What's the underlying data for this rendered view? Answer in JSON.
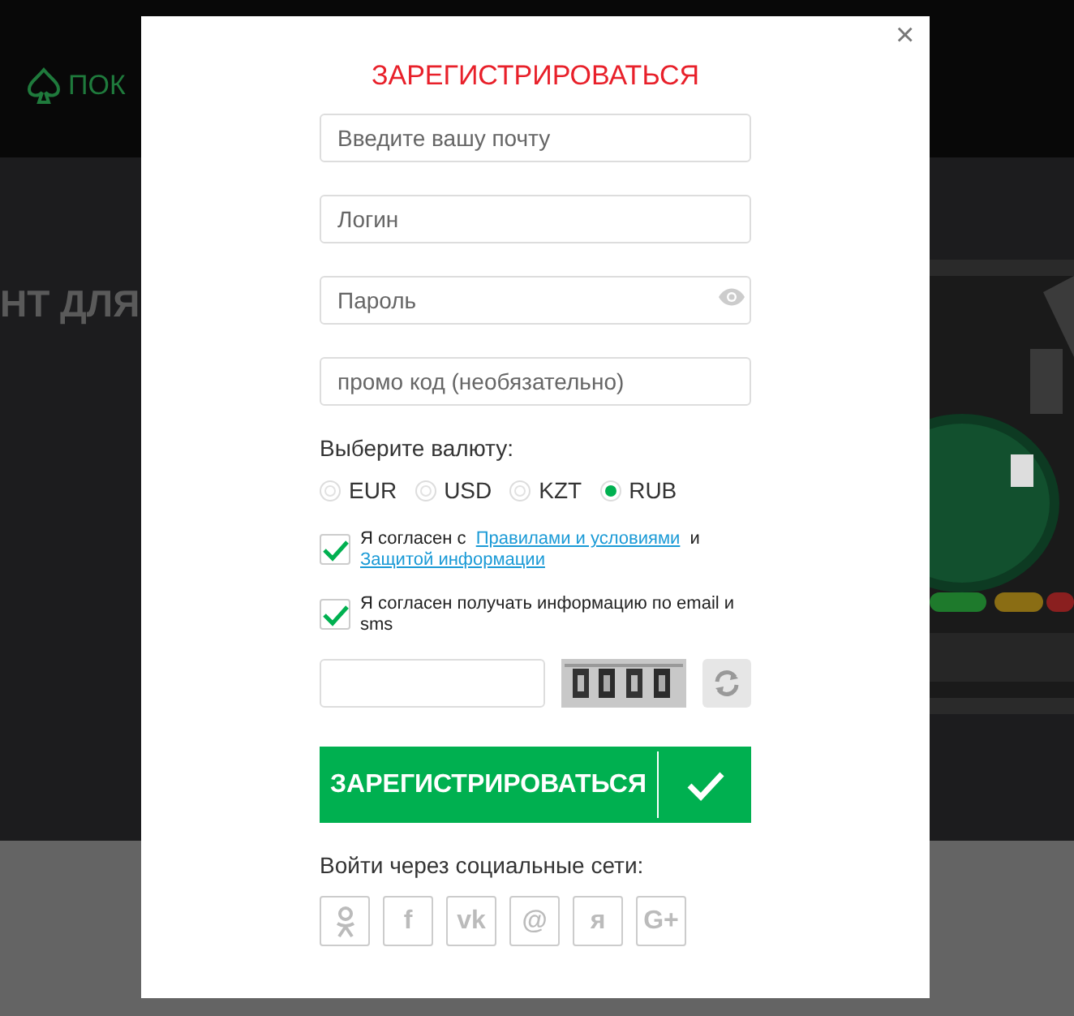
{
  "background": {
    "logo_text": "ПОК",
    "headline": "НТ ДЛЯ"
  },
  "modal": {
    "close": "×",
    "title": "ЗАРЕГИСТРИРОВАТЬСЯ",
    "fields": [
      {
        "placeholder": "Введите вашу почту",
        "kind": "text"
      },
      {
        "placeholder": "Логин",
        "kind": "text"
      },
      {
        "placeholder": "Пароль",
        "kind": "password"
      },
      {
        "placeholder": "промо код (необязательно)",
        "kind": "text"
      }
    ],
    "currency_label": "Выберите валюту:",
    "currencies": [
      {
        "label": "EUR",
        "selected": false
      },
      {
        "label": "USD",
        "selected": false
      },
      {
        "label": "KZT",
        "selected": false
      },
      {
        "label": "RUB",
        "selected": true
      }
    ],
    "agreements": [
      {
        "checked": true,
        "text": "Я согласен с",
        "links": [
          "Правилами и условиями",
          "Защитой информации"
        ],
        "joiner": "и"
      },
      {
        "checked": true,
        "text": "Я согласен получать информацию по email и sms"
      }
    ],
    "submit": "ЗАРЕГИСТРИРОВАТЬСЯ",
    "social_label": "Войти через социальные сети:",
    "social": [
      {
        "kind": "ok"
      },
      {
        "kind": "glyph",
        "glyph": "f"
      },
      {
        "kind": "glyph",
        "glyph": "vk"
      },
      {
        "kind": "glyph",
        "glyph": "@"
      },
      {
        "kind": "glyph",
        "glyph": "я"
      },
      {
        "kind": "glyph",
        "glyph": "G+"
      }
    ]
  }
}
